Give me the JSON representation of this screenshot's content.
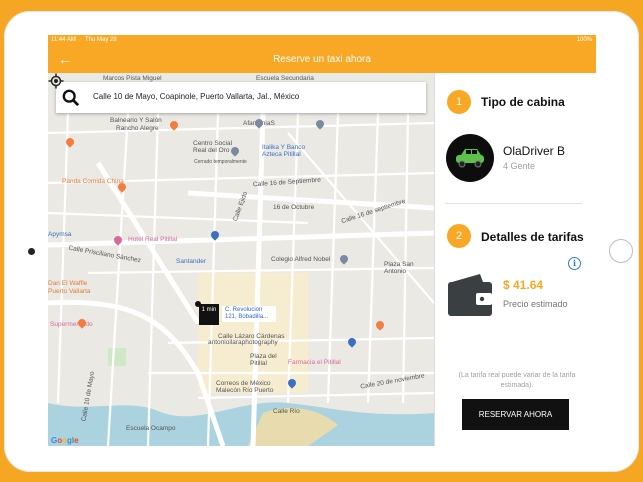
{
  "status_bar": {
    "time": "11:44 AM",
    "date": "Thu May 28",
    "battery": "100%"
  },
  "app_bar": {
    "title": "Reserve un taxi ahora",
    "back_glyph": "←"
  },
  "search": {
    "value": "Calle 10 de Mayo, Coapinole, Puerto Vallarta, Jal., México"
  },
  "map": {
    "pin_time": "1 min",
    "pin_label": "C. Revolucion 121, Bobadilla...",
    "labels": [
      "Escuela Secundaria",
      "Marcos Pista Miguel",
      "Balneario Y Salón",
      "Rancho Alegre",
      "AfamaniaS",
      "Centro Social Real del Oro",
      "Cerrado temporalmente",
      "Italika Y Banco Azteca Pitillal",
      "Panda Comida China",
      "Calle 16 de Septiembre",
      "16 de Octubre",
      "Calle 16 de septiembre",
      "Calle Ejido",
      "Apymsa",
      "Hotel Real Pitillal",
      "Calle Prisciliano Sánchez",
      "Colegio Alfred Nobel",
      "Plaza San Antonio",
      "Santander",
      "Dan El Waffle",
      "Puerto Vallarta",
      "Supermercado",
      "Calle Lázaro Cárdenas",
      "antonioilaraphotography",
      "Plaza del Pitillal",
      "Farmacia el Pitillal",
      "Correos de México Malecón Río Puerto",
      "Calle 20 de noviembre",
      "Calle Río",
      "Calle 10 de Mayo",
      "Escuela Ocampo"
    ],
    "google": "Google"
  },
  "panel": {
    "section1": {
      "number": "1",
      "title": "Tipo de cabina"
    },
    "driver": {
      "name": "OlaDriver B",
      "capacity": "4 Gente"
    },
    "section2": {
      "number": "2",
      "title": "Detalles de tarifas"
    },
    "price": "$ 41.64",
    "price_caption": "Precio estimado",
    "note": "(La tarifa real puede variar de la tarifa estimada).",
    "reserve_button": "RESERVAR AHORA"
  },
  "colors": {
    "accent": "#f9a825",
    "background": "#f5a623",
    "button": "#111111"
  }
}
